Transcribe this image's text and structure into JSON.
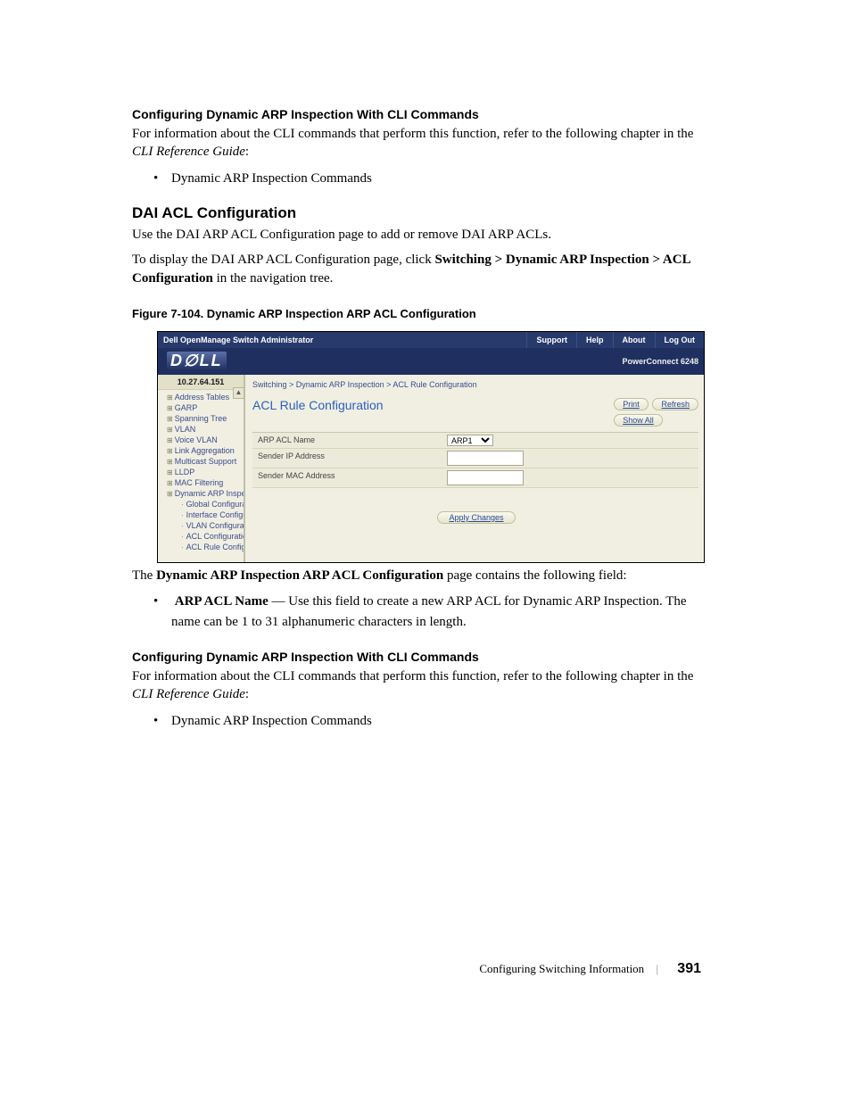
{
  "doc": {
    "h1a": "Configuring Dynamic ARP Inspection With CLI Commands",
    "p1a": "For information about the CLI commands that perform this function, refer to the following chapter in the ",
    "p1a_em": "CLI Reference Guide",
    "p1a_tail": ":",
    "bullet1": "Dynamic ARP Inspection Commands",
    "h2": "DAI ACL Configuration",
    "p2": "Use the DAI ARP ACL Configuration page to add or remove DAI ARP ACLs.",
    "p3a": "To display the DAI ARP ACL Configuration page, click ",
    "p3b": "Switching > Dynamic ARP Inspection > ACL Configuration",
    "p3c": " in the navigation tree.",
    "fig": "Figure 7-104.    Dynamic ARP Inspection ARP ACL Configuration",
    "p4a": "The ",
    "p4b": "Dynamic ARP Inspection ARP ACL Configuration",
    "p4c": " page contains the following field:",
    "b2_lead": "ARP ACL Name",
    "b2_rest": " — Use this field to create a new ARP ACL for Dynamic ARP Inspection. The name can be 1 to 31 alphanumeric characters in length.",
    "h1b": "Configuring Dynamic ARP Inspection With CLI Commands",
    "p5a": "For information about the CLI commands that perform this function, refer to the following chapter in the ",
    "p5a_em": "CLI Reference Guide",
    "p5a_tail": ":",
    "bullet3": "Dynamic ARP Inspection Commands",
    "footer_section": "Configuring Switching Information",
    "footer_page": "391"
  },
  "ss": {
    "admin_title": "Dell OpenManage Switch Administrator",
    "nav": {
      "support": "Support",
      "help": "Help",
      "about": "About",
      "logout": "Log Out"
    },
    "logo": "D∅LL",
    "product": "PowerConnect 6248",
    "ip": "10.27.64.151",
    "tree": [
      "Address Tables",
      "GARP",
      "Spanning Tree",
      "VLAN",
      "Voice VLAN",
      "Link Aggregation",
      "Multicast Support",
      "LLDP",
      "MAC Filtering",
      "Dynamic ARP Inspe"
    ],
    "tree_sub": [
      "Global Configurat",
      "Interface Configu",
      "VLAN Configurat",
      "ACL Configuratio",
      "ACL Rule Config"
    ],
    "crumb": "Switching > Dynamic ARP Inspection > ACL Rule Configuration",
    "panel_title": "ACL Rule Configuration",
    "buttons": {
      "print": "Print",
      "refresh": "Refresh",
      "showall": "Show All",
      "apply": "Apply Changes"
    },
    "form": {
      "name_label": "ARP ACL Name",
      "name_value": "ARP1",
      "ip_label": "Sender IP Address",
      "mac_label": "Sender MAC Address"
    }
  }
}
